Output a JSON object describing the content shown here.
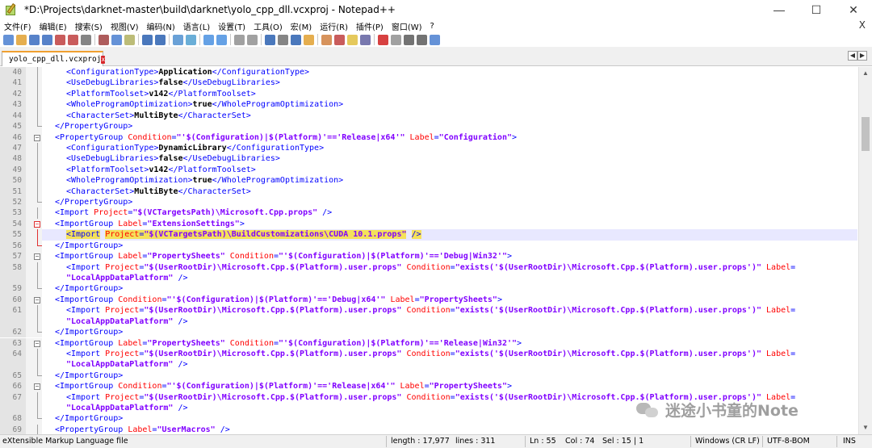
{
  "window": {
    "title": "*D:\\Projects\\darknet-master\\build\\darknet\\yolo_cpp_dll.vcxproj - Notepad++",
    "minimize": "—",
    "maximize": "☐",
    "close": "✕"
  },
  "menu": {
    "items": [
      "文件(F)",
      "编辑(E)",
      "搜索(S)",
      "视图(V)",
      "编码(N)",
      "语言(L)",
      "设置(T)",
      "工具(O)",
      "宏(M)",
      "运行(R)",
      "插件(P)",
      "窗口(W)",
      "?"
    ],
    "close_doc": "X"
  },
  "toolbar": {
    "icons": [
      "new-file-icon",
      "open-file-icon",
      "save-icon",
      "save-all-icon",
      "close-icon",
      "close-all-icon",
      "print-icon",
      "cut-icon",
      "copy-icon",
      "paste-icon",
      "undo-icon",
      "redo-icon",
      "find-icon",
      "replace-icon",
      "zoom-in-icon",
      "zoom-out-icon",
      "sync-v-icon",
      "sync-h-icon",
      "word-wrap-icon",
      "show-all-icon",
      "indent-guide-icon",
      "udl-icon",
      "doc-map-icon",
      "function-list-icon",
      "folder-workspace-icon",
      "monitor-icon",
      "record-macro-icon",
      "stop-macro-icon",
      "play-macro-icon",
      "run-macro-icon",
      "save-macro-icon"
    ]
  },
  "tabs": {
    "active": "yolo_cpp_dll.vcxproj",
    "close": "x",
    "scroll_left": "◀",
    "scroll_right": "▶"
  },
  "editor": {
    "current_line": 55,
    "lines": [
      {
        "n": "40",
        "indent": 3,
        "parts": [
          [
            "tag",
            "<ConfigurationType>"
          ],
          [
            "txt",
            "Application"
          ],
          [
            "tag",
            "</ConfigurationType>"
          ]
        ]
      },
      {
        "n": "41",
        "indent": 3,
        "parts": [
          [
            "tag",
            "<UseDebugLibraries>"
          ],
          [
            "txt",
            "false"
          ],
          [
            "tag",
            "</UseDebugLibraries>"
          ]
        ]
      },
      {
        "n": "42",
        "indent": 3,
        "parts": [
          [
            "tag",
            "<PlatformToolset>"
          ],
          [
            "txt",
            "v142"
          ],
          [
            "tag",
            "</PlatformToolset>"
          ]
        ]
      },
      {
        "n": "43",
        "indent": 3,
        "parts": [
          [
            "tag",
            "<WholeProgramOptimization>"
          ],
          [
            "txt",
            "true"
          ],
          [
            "tag",
            "</WholeProgramOptimization>"
          ]
        ]
      },
      {
        "n": "44",
        "indent": 3,
        "parts": [
          [
            "tag",
            "<CharacterSet>"
          ],
          [
            "txt",
            "MultiByte"
          ],
          [
            "tag",
            "</CharacterSet>"
          ]
        ]
      },
      {
        "n": "45",
        "indent": 2,
        "parts": [
          [
            "tag",
            "</PropertyGroup>"
          ]
        ]
      },
      {
        "n": "46",
        "indent": 2,
        "parts": [
          [
            "tag",
            "<PropertyGroup "
          ],
          [
            "attr",
            "Condition"
          ],
          [
            "tag",
            "="
          ],
          [
            "val",
            "\"'$(Configuration)|$(Platform)'=='Release|x64'\""
          ],
          [
            "tag",
            " "
          ],
          [
            "attr",
            "Label"
          ],
          [
            "tag",
            "="
          ],
          [
            "val",
            "\"Configuration\""
          ],
          [
            "tag",
            ">"
          ]
        ]
      },
      {
        "n": "47",
        "indent": 3,
        "parts": [
          [
            "tag",
            "<ConfigurationType>"
          ],
          [
            "txt",
            "DynamicLibrary"
          ],
          [
            "tag",
            "</ConfigurationType>"
          ]
        ]
      },
      {
        "n": "48",
        "indent": 3,
        "parts": [
          [
            "tag",
            "<UseDebugLibraries>"
          ],
          [
            "txt",
            "false"
          ],
          [
            "tag",
            "</UseDebugLibraries>"
          ]
        ]
      },
      {
        "n": "49",
        "indent": 3,
        "parts": [
          [
            "tag",
            "<PlatformToolset>"
          ],
          [
            "txt",
            "v142"
          ],
          [
            "tag",
            "</PlatformToolset>"
          ]
        ]
      },
      {
        "n": "50",
        "indent": 3,
        "parts": [
          [
            "tag",
            "<WholeProgramOptimization>"
          ],
          [
            "txt",
            "true"
          ],
          [
            "tag",
            "</WholeProgramOptimization>"
          ]
        ]
      },
      {
        "n": "51",
        "indent": 3,
        "parts": [
          [
            "tag",
            "<CharacterSet>"
          ],
          [
            "txt",
            "MultiByte"
          ],
          [
            "tag",
            "</CharacterSet>"
          ]
        ]
      },
      {
        "n": "52",
        "indent": 2,
        "parts": [
          [
            "tag",
            "</PropertyGroup>"
          ]
        ]
      },
      {
        "n": "53",
        "indent": 2,
        "parts": [
          [
            "tag",
            "<Import "
          ],
          [
            "attr",
            "Project"
          ],
          [
            "tag",
            "="
          ],
          [
            "val",
            "\"$(VCTargetsPath)\\Microsoft.Cpp.props\""
          ],
          [
            "tag",
            " />"
          ]
        ]
      },
      {
        "n": "54",
        "indent": 2,
        "parts": [
          [
            "tag",
            "<ImportGroup "
          ],
          [
            "attr",
            "Label"
          ],
          [
            "tag",
            "="
          ],
          [
            "val",
            "\"ExtensionSettings\""
          ],
          [
            "tag",
            ">"
          ]
        ]
      },
      {
        "n": "55",
        "indent": 3,
        "parts": [
          [
            "tag hl",
            "<Import"
          ],
          [
            "tag",
            " "
          ],
          [
            "attr hl",
            "Project"
          ],
          [
            "tag hl",
            "="
          ],
          [
            "val hl",
            "\"$(VCTargetsPath)\\BuildCustomizations\\CUDA 10.1.props\""
          ],
          [
            "tag",
            " "
          ],
          [
            "tag hl",
            "/>"
          ]
        ]
      },
      {
        "n": "56",
        "indent": 2,
        "parts": [
          [
            "tag",
            "</ImportGroup>"
          ]
        ]
      },
      {
        "n": "57",
        "indent": 2,
        "parts": [
          [
            "tag",
            "<ImportGroup "
          ],
          [
            "attr",
            "Label"
          ],
          [
            "tag",
            "="
          ],
          [
            "val",
            "\"PropertySheets\""
          ],
          [
            "tag",
            " "
          ],
          [
            "attr",
            "Condition"
          ],
          [
            "tag",
            "="
          ],
          [
            "val",
            "\"'$(Configuration)|$(Platform)'=='Debug|Win32'\""
          ],
          [
            "tag",
            ">"
          ]
        ]
      },
      {
        "n": "58",
        "indent": 3,
        "parts": [
          [
            "tag",
            "<Import "
          ],
          [
            "attr",
            "Project"
          ],
          [
            "tag",
            "="
          ],
          [
            "val",
            "\"$(UserRootDir)\\Microsoft.Cpp.$(Platform).user.props\""
          ],
          [
            "tag",
            " "
          ],
          [
            "attr",
            "Condition"
          ],
          [
            "tag",
            "="
          ],
          [
            "val",
            "\"exists('$(UserRootDir)\\Microsoft.Cpp.$(Platform).user.props')\""
          ],
          [
            "tag",
            " "
          ],
          [
            "attr",
            "Label"
          ],
          [
            "tag",
            "="
          ]
        ]
      },
      {
        "n": "",
        "indent": 3,
        "parts": [
          [
            "val",
            "\"LocalAppDataPlatform\""
          ],
          [
            "tag",
            " />"
          ]
        ]
      },
      {
        "n": "59",
        "indent": 2,
        "parts": [
          [
            "tag",
            "</ImportGroup>"
          ]
        ]
      },
      {
        "n": "60",
        "indent": 2,
        "parts": [
          [
            "tag",
            "<ImportGroup "
          ],
          [
            "attr",
            "Condition"
          ],
          [
            "tag",
            "="
          ],
          [
            "val",
            "\"'$(Configuration)|$(Platform)'=='Debug|x64'\""
          ],
          [
            "tag",
            " "
          ],
          [
            "attr",
            "Label"
          ],
          [
            "tag",
            "="
          ],
          [
            "val",
            "\"PropertySheets\""
          ],
          [
            "tag",
            ">"
          ]
        ]
      },
      {
        "n": "61",
        "indent": 3,
        "parts": [
          [
            "tag",
            "<Import "
          ],
          [
            "attr",
            "Project"
          ],
          [
            "tag",
            "="
          ],
          [
            "val",
            "\"$(UserRootDir)\\Microsoft.Cpp.$(Platform).user.props\""
          ],
          [
            "tag",
            " "
          ],
          [
            "attr",
            "Condition"
          ],
          [
            "tag",
            "="
          ],
          [
            "val",
            "\"exists('$(UserRootDir)\\Microsoft.Cpp.$(Platform).user.props')\""
          ],
          [
            "tag",
            " "
          ],
          [
            "attr",
            "Label"
          ],
          [
            "tag",
            "="
          ]
        ]
      },
      {
        "n": "",
        "indent": 3,
        "parts": [
          [
            "val",
            "\"LocalAppDataPlatform\""
          ],
          [
            "tag",
            " />"
          ]
        ]
      },
      {
        "n": "62",
        "indent": 2,
        "parts": [
          [
            "tag",
            "</ImportGroup>"
          ]
        ]
      },
      {
        "n": "63",
        "indent": 2,
        "parts": [
          [
            "tag",
            "<ImportGroup "
          ],
          [
            "attr",
            "Label"
          ],
          [
            "tag",
            "="
          ],
          [
            "val",
            "\"PropertySheets\""
          ],
          [
            "tag",
            " "
          ],
          [
            "attr",
            "Condition"
          ],
          [
            "tag",
            "="
          ],
          [
            "val",
            "\"'$(Configuration)|$(Platform)'=='Release|Win32'\""
          ],
          [
            "tag",
            ">"
          ]
        ]
      },
      {
        "n": "64",
        "indent": 3,
        "parts": [
          [
            "tag",
            "<Import "
          ],
          [
            "attr",
            "Project"
          ],
          [
            "tag",
            "="
          ],
          [
            "val",
            "\"$(UserRootDir)\\Microsoft.Cpp.$(Platform).user.props\""
          ],
          [
            "tag",
            " "
          ],
          [
            "attr",
            "Condition"
          ],
          [
            "tag",
            "="
          ],
          [
            "val",
            "\"exists('$(UserRootDir)\\Microsoft.Cpp.$(Platform).user.props')\""
          ],
          [
            "tag",
            " "
          ],
          [
            "attr",
            "Label"
          ],
          [
            "tag",
            "="
          ]
        ]
      },
      {
        "n": "",
        "indent": 3,
        "parts": [
          [
            "val",
            "\"LocalAppDataPlatform\""
          ],
          [
            "tag",
            " />"
          ]
        ]
      },
      {
        "n": "65",
        "indent": 2,
        "parts": [
          [
            "tag",
            "</ImportGroup>"
          ]
        ]
      },
      {
        "n": "66",
        "indent": 2,
        "parts": [
          [
            "tag",
            "<ImportGroup "
          ],
          [
            "attr",
            "Condition"
          ],
          [
            "tag",
            "="
          ],
          [
            "val",
            "\"'$(Configuration)|$(Platform)'=='Release|x64'\""
          ],
          [
            "tag",
            " "
          ],
          [
            "attr",
            "Label"
          ],
          [
            "tag",
            "="
          ],
          [
            "val",
            "\"PropertySheets\""
          ],
          [
            "tag",
            ">"
          ]
        ]
      },
      {
        "n": "67",
        "indent": 3,
        "parts": [
          [
            "tag",
            "<Import "
          ],
          [
            "attr",
            "Project"
          ],
          [
            "tag",
            "="
          ],
          [
            "val",
            "\"$(UserRootDir)\\Microsoft.Cpp.$(Platform).user.props\""
          ],
          [
            "tag",
            " "
          ],
          [
            "attr",
            "Condition"
          ],
          [
            "tag",
            "="
          ],
          [
            "val",
            "\"exists('$(UserRootDir)\\Microsoft.Cpp.$(Platform).user.props')\""
          ],
          [
            "tag",
            " "
          ],
          [
            "attr",
            "Label"
          ],
          [
            "tag",
            "="
          ]
        ]
      },
      {
        "n": "",
        "indent": 3,
        "parts": [
          [
            "val",
            "\"LocalAppDataPlatform\""
          ],
          [
            "tag",
            " />"
          ]
        ]
      },
      {
        "n": "68",
        "indent": 2,
        "parts": [
          [
            "tag",
            "</ImportGroup>"
          ]
        ]
      },
      {
        "n": "69",
        "indent": 2,
        "parts": [
          [
            "tag",
            "<PropertyGroup "
          ],
          [
            "attr",
            "Label"
          ],
          [
            "tag",
            "="
          ],
          [
            "val",
            "\"UserMacros\""
          ],
          [
            "tag",
            " />"
          ]
        ]
      }
    ]
  },
  "statusbar": {
    "file_type": "eXtensible Markup Language file",
    "length": "length : 17,977",
    "lines": "lines : 311",
    "ln": "Ln : 55",
    "col": "Col : 74",
    "sel": "Sel : 15 | 1",
    "eol": "Windows (CR LF)",
    "encoding": "UTF-8-BOM",
    "mode": "INS"
  },
  "watermark": {
    "text": "迷途小书童的Note"
  },
  "colors": {
    "tag": "#0000ff",
    "attr": "#ff0000",
    "value": "#8000ff",
    "highlight": "#f5e15a",
    "current_line": "#e8e8ff"
  }
}
